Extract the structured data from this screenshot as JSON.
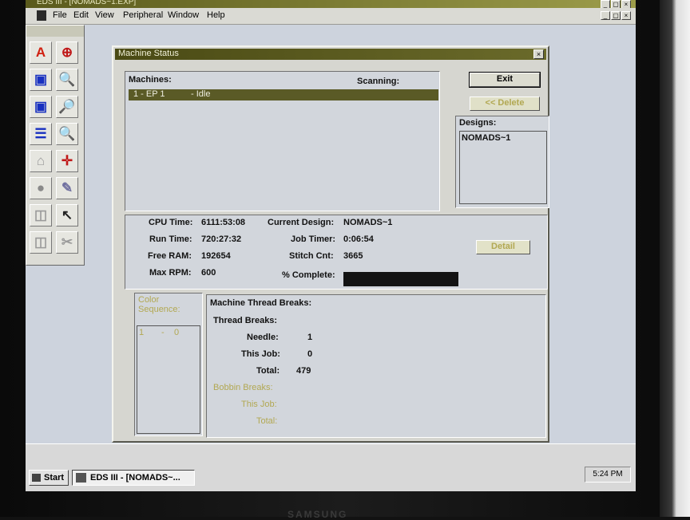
{
  "app": {
    "title": "EDS III - [NOMADS~1.EXP]",
    "menu": [
      "File",
      "Edit",
      "View",
      "Peripheral",
      "Window",
      "Help"
    ],
    "title_buttons": [
      "_",
      "▢",
      "×"
    ],
    "doc_buttons": [
      "_",
      "▢",
      "×"
    ]
  },
  "toolbox": {
    "tools": [
      {
        "name": "text-tool-icon",
        "glyph": "A",
        "color": "#d02010"
      },
      {
        "name": "crosshair-circle-icon",
        "glyph": "⊕",
        "color": "#c01818"
      },
      {
        "name": "machine-arrow-icon",
        "glyph": "▣",
        "color": "#1830c0"
      },
      {
        "name": "zoom-in-icon",
        "glyph": "🔍",
        "color": "#c01818"
      },
      {
        "name": "design-icon",
        "glyph": "▣",
        "color": "#1830c0"
      },
      {
        "name": "zoom-out-icon",
        "glyph": "🔎",
        "color": "#1830c0"
      },
      {
        "name": "list-icon",
        "glyph": "☰",
        "color": "#1830c0"
      },
      {
        "name": "zoom-select-icon",
        "glyph": "🔍",
        "color": "#c01818"
      },
      {
        "name": "outline-icon",
        "glyph": "⌂",
        "color": "#9a9a9a"
      },
      {
        "name": "target-icon",
        "glyph": "✛",
        "color": "#c01818"
      },
      {
        "name": "drop-icon",
        "glyph": "●",
        "color": "#8a8a8a"
      },
      {
        "name": "pen-icon",
        "glyph": "✎",
        "color": "#7070a0"
      },
      {
        "name": "cube-icon",
        "glyph": "◫",
        "color": "#9a9a9a"
      },
      {
        "name": "pointer-icon",
        "glyph": "↖",
        "color": "#222222"
      },
      {
        "name": "box-icon",
        "glyph": "◫",
        "color": "#9a9a9a"
      },
      {
        "name": "scissors-icon",
        "glyph": "✂",
        "color": "#9a9a9a"
      }
    ]
  },
  "machine_status": {
    "title": "Machine Status",
    "close_label": "×",
    "machines_label": "Machines:",
    "scanning_label": "Scanning:",
    "machine_row": {
      "name": "1 - EP 1",
      "status": "- Idle"
    },
    "exit_label": "Exit",
    "delete_label": "<< Delete",
    "designs_label": "Designs:",
    "designs": [
      "NOMADS~1"
    ],
    "stats": {
      "cpu_time_label": "CPU Time:",
      "cpu_time": "6111:53:08",
      "run_time_label": "Run Time:",
      "run_time": "720:27:32",
      "free_ram_label": "Free RAM:",
      "free_ram": "192654",
      "max_rpm_label": "Max RPM:",
      "max_rpm": "600",
      "current_design_label": "Current Design:",
      "current_design": "NOMADS~1",
      "job_timer_label": "Job Timer:",
      "job_timer": "0:06:54",
      "stitch_cnt_label": "Stitch Cnt:",
      "stitch_cnt": "3665",
      "complete_label": "% Complete:"
    },
    "detail_label": "Detail",
    "color_sequence_label": "Color Sequence:",
    "color_sequence_item": {
      "index": "1",
      "sep": "-",
      "value": "0"
    },
    "thread_breaks": {
      "title": "Machine Thread Breaks:",
      "thread_breaks_label": "Thread Breaks:",
      "needle_label": "Needle:",
      "needle": "1",
      "this_job_label": "This Job:",
      "this_job": "0",
      "total_label": "Total:",
      "total": "479",
      "bobbin_breaks_label": "Bobbin Breaks:",
      "bobbin_this_job_label": "This Job:",
      "bobbin_total_label": "Total:"
    }
  },
  "taskbar": {
    "start_label": "Start",
    "task_label": "EDS III - [NOMADS~...",
    "clock": "5:24 PM"
  },
  "monitor_brand": "SAMSUNG"
}
